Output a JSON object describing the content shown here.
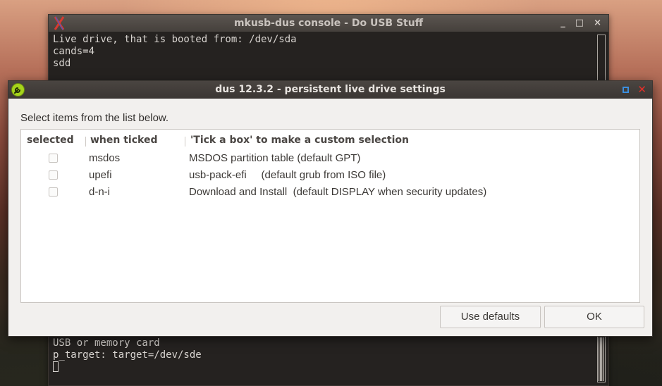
{
  "console": {
    "title": "mkusb-dus console - Do USB Stuff",
    "lines_top": [
      "Live drive, that is booted from: /dev/sda",
      "cands=4",
      "sdd"
    ],
    "lines_bottom": [
      "USB or memory card",
      "p_target: target=/dev/sde"
    ],
    "controls": [
      "_",
      "□",
      "×"
    ]
  },
  "dialog": {
    "title": "dus 12.3.2 - persistent live drive settings",
    "prompt": "Select items from the list below.",
    "columns": [
      "selected",
      "when ticked",
      "'Tick a box' to make a custom selection"
    ],
    "rows": [
      {
        "selected": false,
        "when": "msdos",
        "desc": "MSDOS partition table (default GPT)"
      },
      {
        "selected": false,
        "when": "upefi",
        "desc": "usb-pack-efi     (default grub from ISO file)"
      },
      {
        "selected": false,
        "when": "d-n-i",
        "desc": "Download and Install  (default DISPLAY when security updates)"
      }
    ],
    "buttons": {
      "defaults": "Use defaults",
      "ok": "OK"
    }
  },
  "colors": {
    "titlebar": "#45403c",
    "accent_blue": "#3b8fe0",
    "close_red": "#e0302a",
    "app_icon_green": "#a6d41b"
  }
}
